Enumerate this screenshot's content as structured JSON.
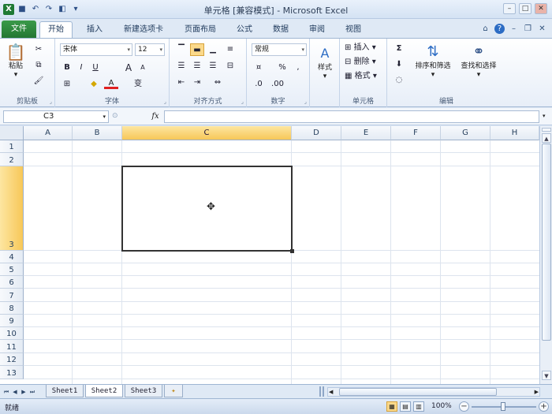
{
  "window": {
    "title": "单元格 [兼容模式] - Microsoft Excel",
    "minimize_label": "–",
    "maximize_label": "□",
    "close_label": "✕"
  },
  "qat": {
    "icon_names": [
      "excel-icon",
      "save-icon",
      "undo-icon",
      "redo-icon",
      "print-preview-icon",
      "customize-qat-icon"
    ],
    "glyphs": [
      "X",
      "■",
      "↶",
      "↷",
      "◧",
      "▾"
    ]
  },
  "tabs": {
    "file": "文件",
    "items": [
      "开始",
      "插入",
      "新建选项卡",
      "页面布局",
      "公式",
      "数据",
      "审阅",
      "视图"
    ],
    "active": "开始"
  },
  "ribbon": {
    "clipboard": {
      "paste": "粘贴",
      "group": "剪贴板"
    },
    "font": {
      "font_name": "宋体",
      "font_size": "12",
      "bold": "B",
      "italic": "I",
      "underline": "U",
      "grow": "A",
      "shrink": "A",
      "fontcolor": "A",
      "wen": "变",
      "group": "字体"
    },
    "alignment": {
      "group": "对齐方式"
    },
    "number": {
      "format": "常规",
      "percent": "%",
      "comma": ",",
      "group": "数字"
    },
    "styles": {
      "label": "样式",
      "group": ""
    },
    "cells": {
      "insert": "插入",
      "delete": "删除",
      "format": "格式",
      "group": "单元格"
    },
    "editing": {
      "sum": "Σ",
      "sort_filter": "排序和筛选",
      "find_select": "查找和选择",
      "group": "编辑"
    }
  },
  "formula_bar": {
    "name_box": "C3",
    "fx": "fx",
    "formula": ""
  },
  "grid": {
    "columns": [
      "A",
      "B",
      "C",
      "D",
      "E",
      "F",
      "G",
      "H"
    ],
    "rows": [
      "1",
      "2",
      "3",
      "4",
      "5",
      "6",
      "7",
      "8",
      "9",
      "10",
      "11",
      "12",
      "13"
    ],
    "selected_column": "C",
    "selected_row": "3"
  },
  "sheets": {
    "tabs": [
      "Sheet1",
      "Sheet2",
      "Sheet3"
    ],
    "active": "Sheet2"
  },
  "status": {
    "text": "就绪",
    "zoom": "100%",
    "zoom_minus": "−",
    "zoom_plus": "+"
  },
  "colors": {
    "file_tab": "#2e8b3d",
    "selection_header": "#f7c758",
    "ribbon_border": "#9fb6d3"
  }
}
